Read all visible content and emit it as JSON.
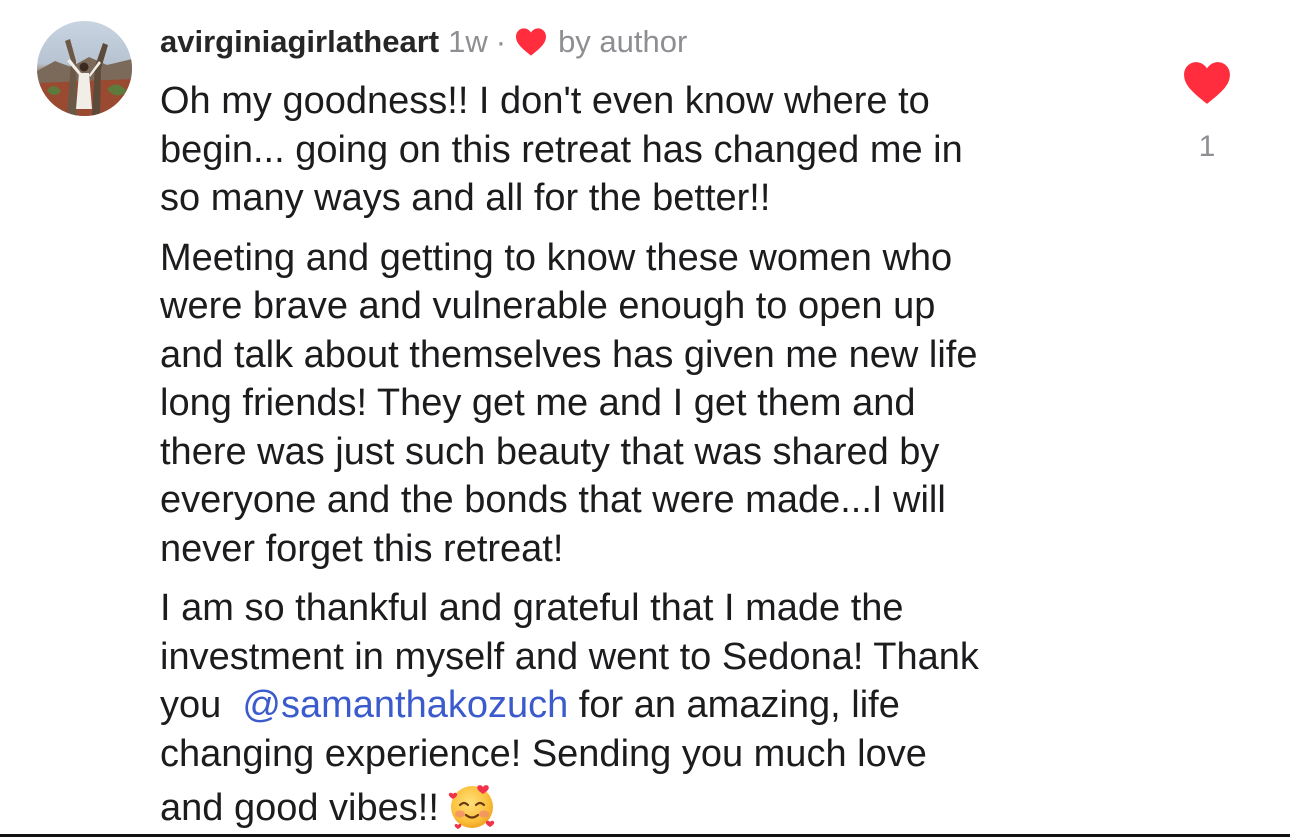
{
  "comment": {
    "avatar_icon": "profile-photo-avatar",
    "username": "avirginiagirlatheart",
    "timestamp": "1w",
    "separator": "·",
    "author_heart_icon": "heart-icon",
    "author_heart_color": "#ff2d3d",
    "by_author": "by author",
    "paragraphs": [
      {
        "lines": [
          "Oh my goodness!! I don't even know where to",
          "begin... going on this retreat has changed me in",
          "so many ways and all for the better!!"
        ]
      },
      {
        "lines": [
          "Meeting and getting to know these women who",
          "were brave and vulnerable enough to open up",
          "and talk about themselves has given me new life",
          "long friends!  They get me and I get them and",
          "there was just such beauty that was shared by",
          "everyone and the bonds that were made...I will",
          "never forget this retreat!"
        ]
      },
      {
        "lines": [
          "I am so thankful and grateful that I made the",
          "investment in myself and went to Sedona!  Thank"
        ],
        "mention_line": {
          "before": "you  ",
          "mention": "@samanthakozuch",
          "after": " for an amazing, life"
        },
        "lines_after": [
          "changing experience!  Sending you much love"
        ],
        "last_line": "and good vibes!!",
        "emoji_icon": "smiling-face-with-hearts-emoji"
      }
    ],
    "mention_color": "#3b5bcc"
  },
  "like": {
    "icon": "heart-icon",
    "color": "#ff2d3d",
    "count": "1"
  }
}
